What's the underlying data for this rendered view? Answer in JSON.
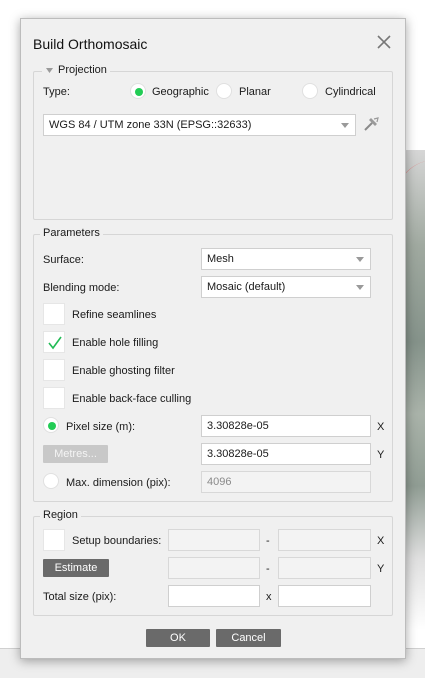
{
  "dialog": {
    "title": "Build Orthomosaic",
    "close_icon": "close-icon"
  },
  "projection": {
    "legend": "Projection",
    "type_label": "Type:",
    "types": [
      {
        "label": "Geographic",
        "selected": true
      },
      {
        "label": "Planar",
        "selected": false
      },
      {
        "label": "Cylindrical",
        "selected": false
      }
    ],
    "crs_value": "WGS 84 / UTM zone 33N (EPSG::32633)",
    "crs_tool_icon": "crs-settings-icon"
  },
  "parameters": {
    "legend": "Parameters",
    "surface_label": "Surface:",
    "surface_value": "Mesh",
    "blending_label": "Blending mode:",
    "blending_value": "Mosaic (default)",
    "refine_seamlines": {
      "label": "Refine seamlines",
      "checked": false
    },
    "hole_filling": {
      "label": "Enable hole filling",
      "checked": true
    },
    "ghosting_filter": {
      "label": "Enable ghosting filter",
      "checked": false
    },
    "backface_culling": {
      "label": "Enable back-face culling",
      "checked": false
    },
    "pixel_size_label": "Pixel size (m):",
    "pixel_size_x": "3.30828e-05",
    "pixel_size_y": "3.30828e-05",
    "x_label": "X",
    "y_label": "Y",
    "metres_button": "Metres...",
    "max_dimension_label": "Max. dimension (pix):",
    "max_dimension_value": "4096"
  },
  "region": {
    "legend": "Region",
    "setup_boundaries_label": "Setup boundaries:",
    "dash": "-",
    "x_label": "X",
    "y_label": "Y",
    "estimate_button": "Estimate",
    "total_size_label": "Total size (pix):",
    "times": "x"
  },
  "buttons": {
    "ok": "OK",
    "cancel": "Cancel"
  },
  "colors": {
    "radio_selected": "#22cc55",
    "button_bg": "#6a6a6a",
    "dialog_bg": "#f0f0f0"
  }
}
